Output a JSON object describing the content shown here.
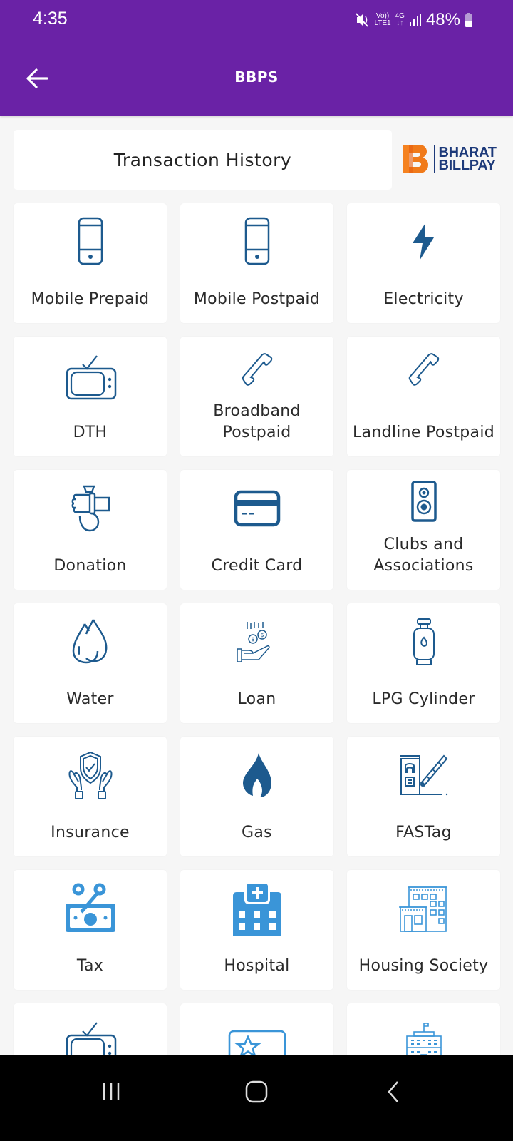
{
  "status_bar": {
    "time": "4:35",
    "volte": "Vo))",
    "lte": "LTE1",
    "network": "4G",
    "battery_percent": "48%",
    "icons": [
      "mute-icon",
      "volte-icon",
      "4g-icon",
      "signal-icon",
      "battery-icon"
    ]
  },
  "app_bar": {
    "title": "BBPS",
    "back_icon": "arrow-left-icon"
  },
  "transaction_history": {
    "label": "Transaction History"
  },
  "brand": {
    "line1": "BHARAT",
    "line2": "BILLPAY",
    "colors": {
      "orange": "#f07a1a",
      "navy": "#1d3a7a"
    }
  },
  "theme": {
    "primary": "#6a22a6",
    "icon_dark_blue": "#1d5a8e",
    "icon_light_blue": "#3a95d8"
  },
  "categories": [
    {
      "label": "Mobile Prepaid",
      "icon": "mobile-phone-icon"
    },
    {
      "label": "Mobile Postpaid",
      "icon": "mobile-phone-icon"
    },
    {
      "label": "Electricity",
      "icon": "lightning-icon"
    },
    {
      "label": "DTH",
      "icon": "tv-icon"
    },
    {
      "label": "Broadband Postpaid",
      "icon": "telephone-icon"
    },
    {
      "label": "Landline Postpaid",
      "icon": "telephone-icon"
    },
    {
      "label": "Donation",
      "icon": "donation-hand-icon"
    },
    {
      "label": "Credit Card",
      "icon": "credit-card-icon"
    },
    {
      "label": "Clubs and Associations",
      "icon": "speaker-icon"
    },
    {
      "label": "Water",
      "icon": "water-drop-icon"
    },
    {
      "label": "Loan",
      "icon": "loan-coins-hand-icon"
    },
    {
      "label": "LPG Cylinder",
      "icon": "gas-cylinder-icon"
    },
    {
      "label": "Insurance",
      "icon": "shield-hands-icon"
    },
    {
      "label": "Gas",
      "icon": "flame-icon"
    },
    {
      "label": "FASTag",
      "icon": "toll-gate-icon"
    },
    {
      "label": "Tax",
      "icon": "tax-percent-icon"
    },
    {
      "label": "Hospital",
      "icon": "hospital-icon"
    },
    {
      "label": "Housing Society",
      "icon": "building-icon"
    },
    {
      "label": "",
      "icon": "tv-icon"
    },
    {
      "label": "",
      "icon": "star-card-icon"
    },
    {
      "label": "",
      "icon": "government-building-icon"
    }
  ],
  "nav_bar": {
    "buttons": [
      "recent-apps",
      "home",
      "back"
    ]
  }
}
